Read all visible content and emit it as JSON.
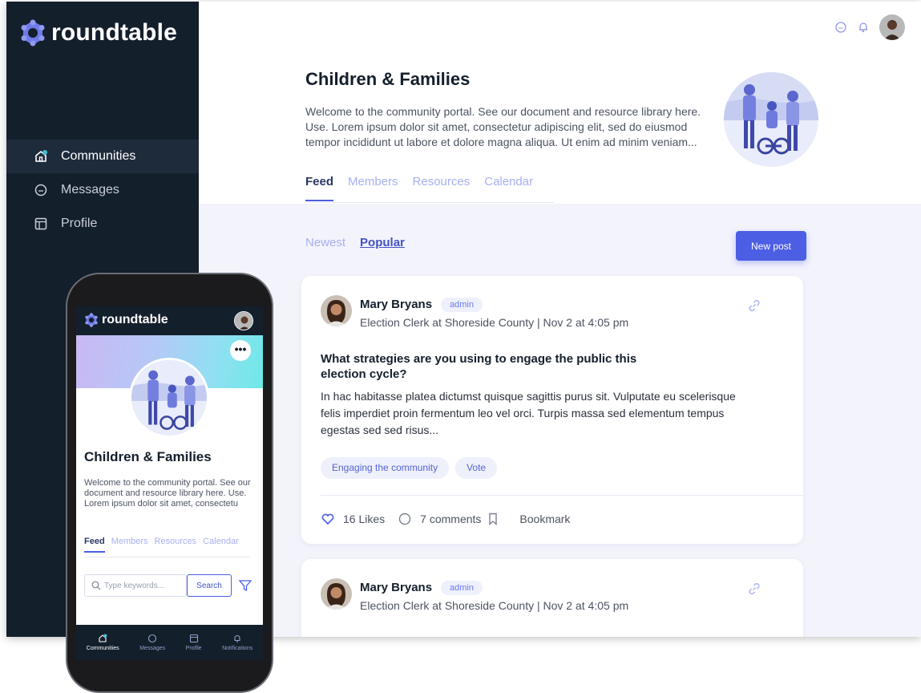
{
  "app": {
    "name": "roundtable"
  },
  "sidebar": {
    "items": [
      {
        "label": "Communities",
        "icon": "home-icon",
        "active": true
      },
      {
        "label": "Messages",
        "icon": "chat-icon",
        "active": false
      },
      {
        "label": "Profile",
        "icon": "profile-icon",
        "active": false
      }
    ]
  },
  "topbar": {
    "icons": [
      "chat-icon",
      "bell-icon",
      "user-avatar"
    ]
  },
  "community": {
    "title": "Children & Families",
    "description": "Welcome to the community portal. See our document and resource library here. Use. Lorem ipsum dolor sit amet, consectetur adipiscing elit, sed do eiusmod tempor incididunt ut labore et dolore magna aliqua. Ut enim ad minim veniam...",
    "tabs": [
      "Feed",
      "Members",
      "Resources",
      "Calendar"
    ],
    "active_tab": "Feed"
  },
  "feed": {
    "sort": [
      "Newest",
      "Popular"
    ],
    "active_sort": "Popular",
    "new_post_label": "New post"
  },
  "posts": [
    {
      "author": "Mary Bryans",
      "badge": "admin",
      "meta": "Election Clerk at Shoreside County | Nov 2 at 4:05 pm",
      "title": "What strategies are you using to engage the public this election cycle?",
      "body": "In hac habitasse platea dictumst quisque sagittis purus sit. Vulputate eu scelerisque felis imperdiet proin fermentum leo vel orci. Turpis massa sed elementum tempus egestas sed sed risus...",
      "tags": [
        "Engaging the community",
        "Vote"
      ],
      "likes": "16 Likes",
      "comments": "7 comments",
      "bookmark": "Bookmark"
    },
    {
      "author": "Mary Bryans",
      "badge": "admin",
      "meta": "Election Clerk at Shoreside County | Nov 2 at 4:05 pm"
    }
  ],
  "phone": {
    "app_name": "roundtable",
    "more": "•••",
    "title": "Children & Families",
    "description": "Welcome to the community portal. See our document and resource library here. Use. Lorem ipsum dolor sit amet, consectetu",
    "tabs": [
      "Feed",
      "Members",
      "Resources",
      "Calendar"
    ],
    "search_placeholder": "Type keywords...",
    "search_button": "Search",
    "bottom_nav": [
      "Communities",
      "Messages",
      "Profile",
      "Notifications"
    ]
  },
  "colors": {
    "sidebar_bg": "#141f2c",
    "accent": "#4b5ee4",
    "tab_inactive": "#a7aff0",
    "content_bg": "#f3f3fc"
  }
}
